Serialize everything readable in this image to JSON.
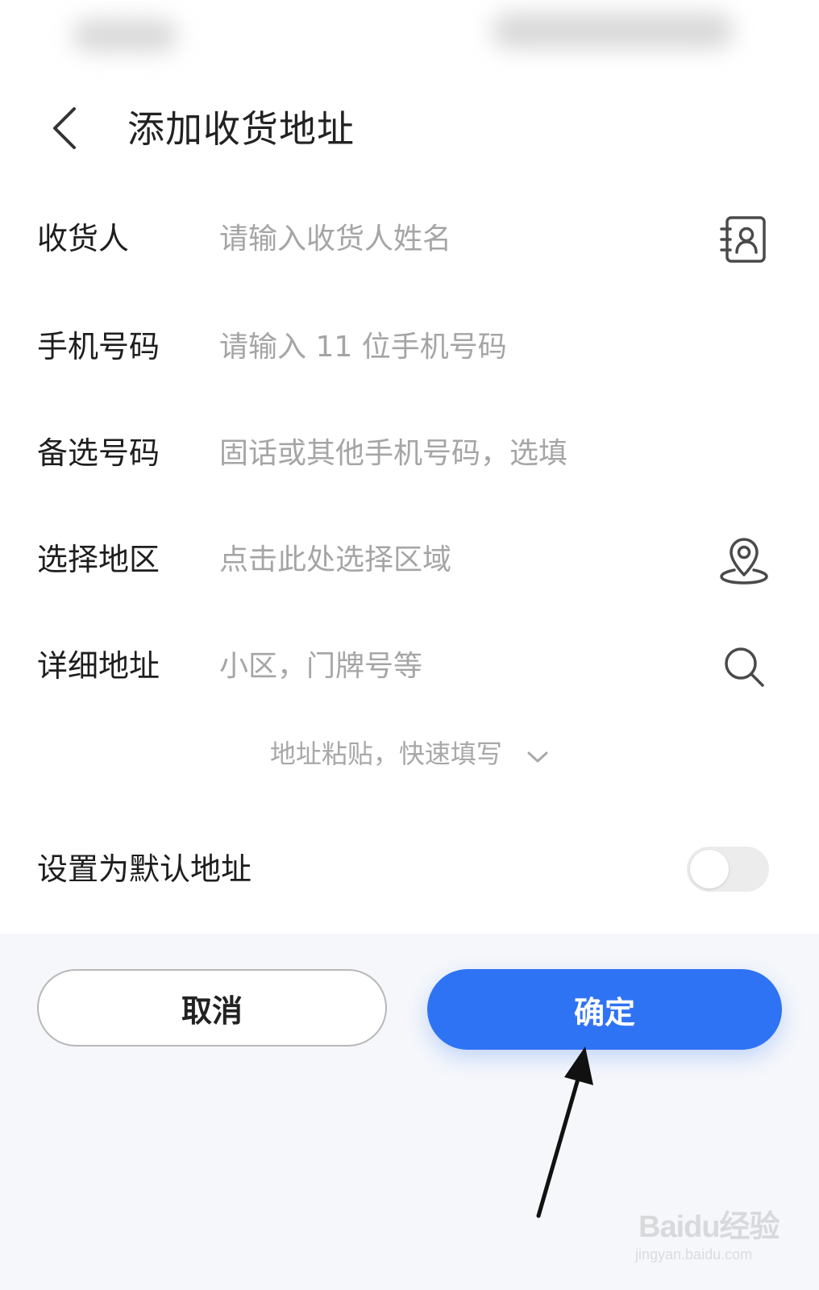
{
  "header": {
    "title": "添加收货地址"
  },
  "form": {
    "recipient": {
      "label": "收货人",
      "placeholder": "请输入收货人姓名"
    },
    "phone": {
      "label": "手机号码",
      "placeholder": "请输入 11 位手机号码"
    },
    "alt_phone": {
      "label": "备选号码",
      "placeholder": "固话或其他手机号码，选填"
    },
    "region": {
      "label": "选择地区",
      "placeholder": "点击此处选择区域"
    },
    "detail": {
      "label": "详细地址",
      "placeholder": "小区，门牌号等"
    }
  },
  "paste": {
    "label": "地址粘贴，快速填写"
  },
  "default_address": {
    "label": "设置为默认地址",
    "enabled": false
  },
  "buttons": {
    "cancel": "取消",
    "confirm": "确定"
  },
  "icons": {
    "back": "chevron-left-icon",
    "contacts": "contact-book-icon",
    "location": "location-pin-icon",
    "search": "search-icon",
    "expand": "chevron-down-icon"
  },
  "colors": {
    "primary": "#2f73f5",
    "placeholder": "#a5a5a5",
    "toggle_off": "#ececec"
  },
  "watermark": {
    "brand": "Baidu经验",
    "url": "jingyan.baidu.com"
  }
}
